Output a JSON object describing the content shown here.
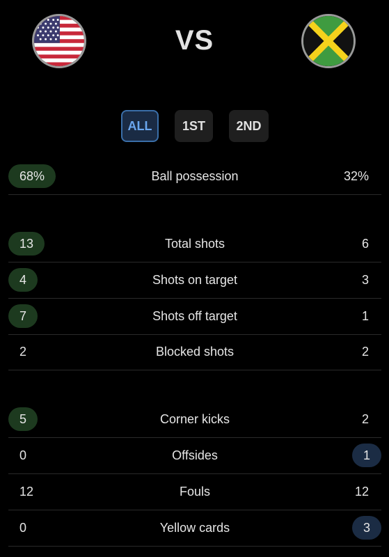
{
  "header": {
    "home_flag": "usa-flag-icon",
    "away_flag": "jamaica-flag-icon",
    "vs_label": "VS"
  },
  "tabs": [
    {
      "label": "ALL",
      "active": true
    },
    {
      "label": "1ST",
      "active": false
    },
    {
      "label": "2ND",
      "active": false
    }
  ],
  "colors": {
    "home_highlight": "#1d3a1f",
    "away_highlight": "#1b2c44",
    "tab_active_text": "#6aa6ee",
    "tab_active_border": "#3a6ea8"
  },
  "stats": [
    {
      "label": "Ball possession",
      "home": "68%",
      "away": "32%",
      "leader": "home"
    },
    {
      "label": "Total shots",
      "home": "13",
      "away": "6",
      "leader": "home"
    },
    {
      "label": "Shots on target",
      "home": "4",
      "away": "3",
      "leader": "home"
    },
    {
      "label": "Shots off target",
      "home": "7",
      "away": "1",
      "leader": "home"
    },
    {
      "label": "Blocked shots",
      "home": "2",
      "away": "2",
      "leader": "none"
    },
    {
      "label": "Corner kicks",
      "home": "5",
      "away": "2",
      "leader": "home"
    },
    {
      "label": "Offsides",
      "home": "0",
      "away": "1",
      "leader": "away"
    },
    {
      "label": "Fouls",
      "home": "12",
      "away": "12",
      "leader": "none"
    },
    {
      "label": "Yellow cards",
      "home": "0",
      "away": "3",
      "leader": "away"
    }
  ]
}
